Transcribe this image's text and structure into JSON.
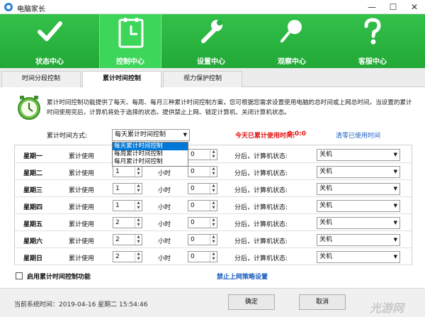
{
  "window": {
    "title": "电脑家长",
    "min": "—",
    "max": "☐",
    "close": "✕"
  },
  "nav": [
    {
      "label": "状态中心",
      "icon": "check-icon"
    },
    {
      "label": "控制中心",
      "icon": "clock-icon"
    },
    {
      "label": "设置中心",
      "icon": "wrench-icon"
    },
    {
      "label": "观察中心",
      "icon": "magnifier-icon"
    },
    {
      "label": "客服中心",
      "icon": "question-icon"
    }
  ],
  "active_nav": "控制中心",
  "tabs": [
    {
      "label": "时间分段控制"
    },
    {
      "label": "累计时间控制"
    },
    {
      "label": "视力保护控制"
    }
  ],
  "active_tab": "累计时间控制",
  "description": "累计时间控制功能提供了每天、每周、每月三种累计时间控制方案，您可根据您需求设置使用电脑的总时间或上网总时间，当设置的累计时间使用完后，计算机将处于选择的状态。提供禁止上网、锁定计算机、关闭计算机状态。",
  "mode": {
    "label": "累计时间方式:",
    "selected": "每天累计时间控制",
    "options": [
      "每天累计时间控制",
      "每周累计时间控制",
      "每月累计时间控制"
    ]
  },
  "today": {
    "label": "今天已累计使用时间:",
    "value": "0:0:0"
  },
  "clear_link": "清零已使用时间",
  "schedule": {
    "usage_label": "累计使用",
    "hour_unit": "小时",
    "after_label": "分后，计算机状态:",
    "rows": [
      {
        "day": "星期一",
        "hours": "1",
        "minutes": "0",
        "state": "关机"
      },
      {
        "day": "星期二",
        "hours": "1",
        "minutes": "0",
        "state": "关机"
      },
      {
        "day": "星期三",
        "hours": "1",
        "minutes": "0",
        "state": "关机"
      },
      {
        "day": "星期四",
        "hours": "1",
        "minutes": "0",
        "state": "关机"
      },
      {
        "day": "星期五",
        "hours": "2",
        "minutes": "0",
        "state": "关机"
      },
      {
        "day": "星期六",
        "hours": "2",
        "minutes": "0",
        "state": "关机"
      },
      {
        "day": "星期日",
        "hours": "2",
        "minutes": "0",
        "state": "关机"
      }
    ]
  },
  "enable_label": "启用累计时间控制功能",
  "policy_link": "禁止上网策略设置",
  "footer": {
    "system_time": "当前系统时间：2019-04-16 星期二 15:54:46",
    "ok": "确定",
    "cancel": "取消"
  },
  "colors": {
    "nav_green": "#22a836",
    "link_blue": "#1a5fc0",
    "alert_red": "#e01010"
  }
}
